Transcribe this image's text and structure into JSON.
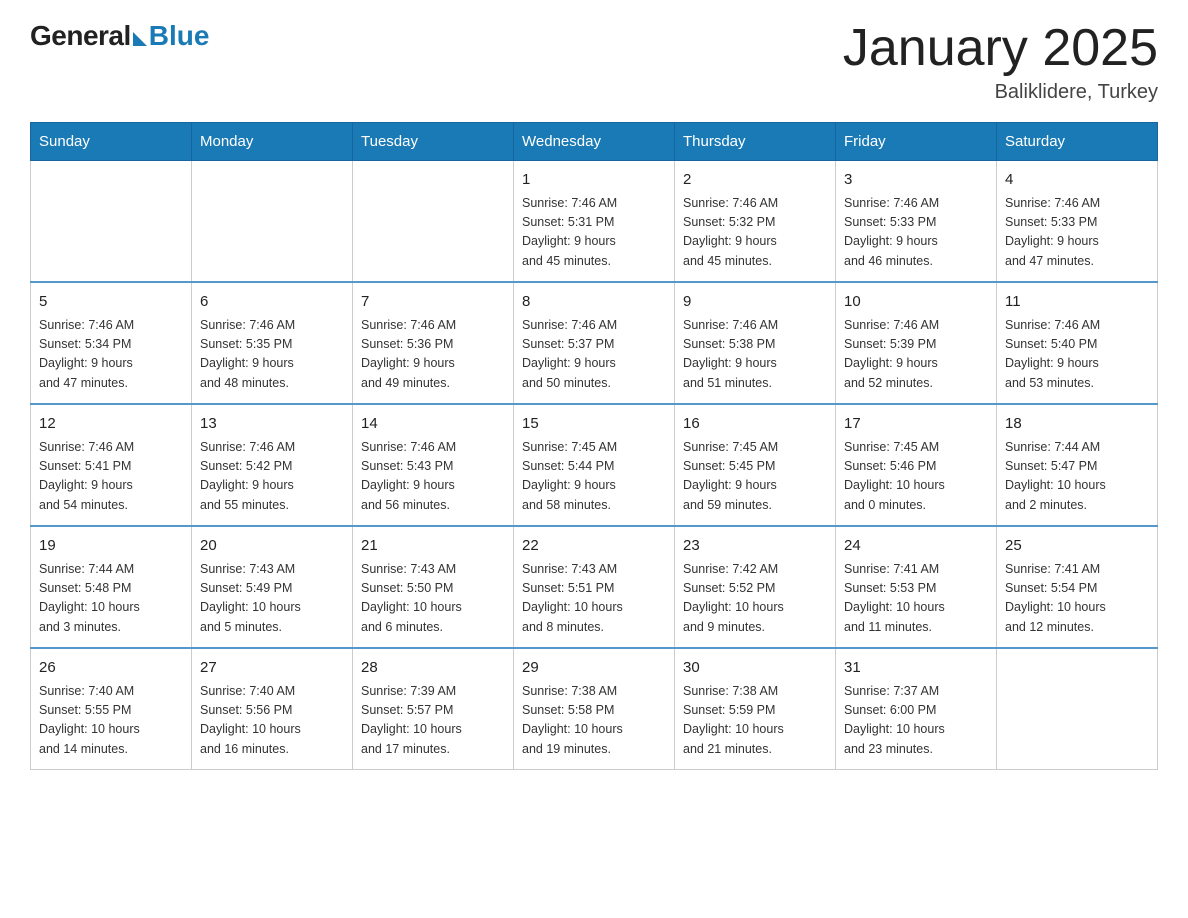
{
  "header": {
    "logo_general": "General",
    "logo_blue": "Blue",
    "title": "January 2025",
    "location": "Baliklidere, Turkey"
  },
  "days_of_week": [
    "Sunday",
    "Monday",
    "Tuesday",
    "Wednesday",
    "Thursday",
    "Friday",
    "Saturday"
  ],
  "weeks": [
    [
      {
        "day": "",
        "info": ""
      },
      {
        "day": "",
        "info": ""
      },
      {
        "day": "",
        "info": ""
      },
      {
        "day": "1",
        "info": "Sunrise: 7:46 AM\nSunset: 5:31 PM\nDaylight: 9 hours\nand 45 minutes."
      },
      {
        "day": "2",
        "info": "Sunrise: 7:46 AM\nSunset: 5:32 PM\nDaylight: 9 hours\nand 45 minutes."
      },
      {
        "day": "3",
        "info": "Sunrise: 7:46 AM\nSunset: 5:33 PM\nDaylight: 9 hours\nand 46 minutes."
      },
      {
        "day": "4",
        "info": "Sunrise: 7:46 AM\nSunset: 5:33 PM\nDaylight: 9 hours\nand 47 minutes."
      }
    ],
    [
      {
        "day": "5",
        "info": "Sunrise: 7:46 AM\nSunset: 5:34 PM\nDaylight: 9 hours\nand 47 minutes."
      },
      {
        "day": "6",
        "info": "Sunrise: 7:46 AM\nSunset: 5:35 PM\nDaylight: 9 hours\nand 48 minutes."
      },
      {
        "day": "7",
        "info": "Sunrise: 7:46 AM\nSunset: 5:36 PM\nDaylight: 9 hours\nand 49 minutes."
      },
      {
        "day": "8",
        "info": "Sunrise: 7:46 AM\nSunset: 5:37 PM\nDaylight: 9 hours\nand 50 minutes."
      },
      {
        "day": "9",
        "info": "Sunrise: 7:46 AM\nSunset: 5:38 PM\nDaylight: 9 hours\nand 51 minutes."
      },
      {
        "day": "10",
        "info": "Sunrise: 7:46 AM\nSunset: 5:39 PM\nDaylight: 9 hours\nand 52 minutes."
      },
      {
        "day": "11",
        "info": "Sunrise: 7:46 AM\nSunset: 5:40 PM\nDaylight: 9 hours\nand 53 minutes."
      }
    ],
    [
      {
        "day": "12",
        "info": "Sunrise: 7:46 AM\nSunset: 5:41 PM\nDaylight: 9 hours\nand 54 minutes."
      },
      {
        "day": "13",
        "info": "Sunrise: 7:46 AM\nSunset: 5:42 PM\nDaylight: 9 hours\nand 55 minutes."
      },
      {
        "day": "14",
        "info": "Sunrise: 7:46 AM\nSunset: 5:43 PM\nDaylight: 9 hours\nand 56 minutes."
      },
      {
        "day": "15",
        "info": "Sunrise: 7:45 AM\nSunset: 5:44 PM\nDaylight: 9 hours\nand 58 minutes."
      },
      {
        "day": "16",
        "info": "Sunrise: 7:45 AM\nSunset: 5:45 PM\nDaylight: 9 hours\nand 59 minutes."
      },
      {
        "day": "17",
        "info": "Sunrise: 7:45 AM\nSunset: 5:46 PM\nDaylight: 10 hours\nand 0 minutes."
      },
      {
        "day": "18",
        "info": "Sunrise: 7:44 AM\nSunset: 5:47 PM\nDaylight: 10 hours\nand 2 minutes."
      }
    ],
    [
      {
        "day": "19",
        "info": "Sunrise: 7:44 AM\nSunset: 5:48 PM\nDaylight: 10 hours\nand 3 minutes."
      },
      {
        "day": "20",
        "info": "Sunrise: 7:43 AM\nSunset: 5:49 PM\nDaylight: 10 hours\nand 5 minutes."
      },
      {
        "day": "21",
        "info": "Sunrise: 7:43 AM\nSunset: 5:50 PM\nDaylight: 10 hours\nand 6 minutes."
      },
      {
        "day": "22",
        "info": "Sunrise: 7:43 AM\nSunset: 5:51 PM\nDaylight: 10 hours\nand 8 minutes."
      },
      {
        "day": "23",
        "info": "Sunrise: 7:42 AM\nSunset: 5:52 PM\nDaylight: 10 hours\nand 9 minutes."
      },
      {
        "day": "24",
        "info": "Sunrise: 7:41 AM\nSunset: 5:53 PM\nDaylight: 10 hours\nand 11 minutes."
      },
      {
        "day": "25",
        "info": "Sunrise: 7:41 AM\nSunset: 5:54 PM\nDaylight: 10 hours\nand 12 minutes."
      }
    ],
    [
      {
        "day": "26",
        "info": "Sunrise: 7:40 AM\nSunset: 5:55 PM\nDaylight: 10 hours\nand 14 minutes."
      },
      {
        "day": "27",
        "info": "Sunrise: 7:40 AM\nSunset: 5:56 PM\nDaylight: 10 hours\nand 16 minutes."
      },
      {
        "day": "28",
        "info": "Sunrise: 7:39 AM\nSunset: 5:57 PM\nDaylight: 10 hours\nand 17 minutes."
      },
      {
        "day": "29",
        "info": "Sunrise: 7:38 AM\nSunset: 5:58 PM\nDaylight: 10 hours\nand 19 minutes."
      },
      {
        "day": "30",
        "info": "Sunrise: 7:38 AM\nSunset: 5:59 PM\nDaylight: 10 hours\nand 21 minutes."
      },
      {
        "day": "31",
        "info": "Sunrise: 7:37 AM\nSunset: 6:00 PM\nDaylight: 10 hours\nand 23 minutes."
      },
      {
        "day": "",
        "info": ""
      }
    ]
  ]
}
